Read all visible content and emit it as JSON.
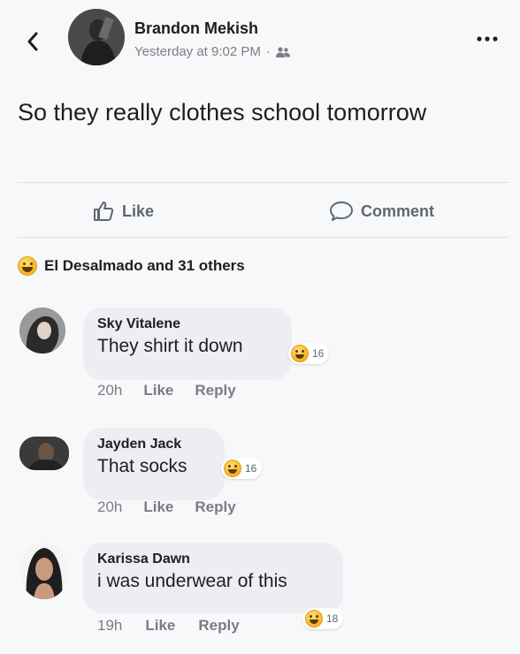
{
  "post": {
    "author": "Brandon Mekish",
    "timestamp": "Yesterday at 9:02 PM",
    "separator": "·",
    "privacy_icon": "friends-icon",
    "text": "So they really clothes school tomorrow"
  },
  "actions": {
    "like_label": "Like",
    "comment_label": "Comment"
  },
  "reactions": {
    "summary": "El Desalmado and 31 others",
    "icon": "haha-emoji-icon"
  },
  "comments": [
    {
      "name": "Sky Vitalene",
      "text": "They shirt it down",
      "reaction_count": "16",
      "time": "20h",
      "like": "Like",
      "reply": "Reply"
    },
    {
      "name": "Jayden Jack",
      "text": "That socks",
      "reaction_count": "16",
      "time": "20h",
      "like": "Like",
      "reply": "Reply"
    },
    {
      "name": "Karissa Dawn",
      "text": "i was underwear of this",
      "reaction_count": "18",
      "time": "19h",
      "like": "Like",
      "reply": "Reply"
    }
  ],
  "colors": {
    "background": "#f7f8fa",
    "bubble": "#eceef1",
    "muted_text": "#7a7d82",
    "emoji_yellow": "#f7b125"
  }
}
